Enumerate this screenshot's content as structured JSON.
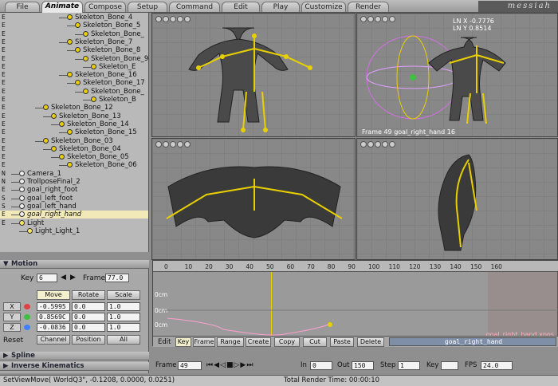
{
  "tabs": [
    "File",
    "Animate",
    "Compose",
    "Setup",
    "Command",
    "Edit",
    "Play",
    "Customize",
    "Render"
  ],
  "logo": "messiah",
  "tree": [
    {
      "flag": "E",
      "label": "Skeleton_Bone_4"
    },
    {
      "flag": "E",
      "label": "Skeleton_Bone_5"
    },
    {
      "flag": "E",
      "label": "Skeleton_Bone_"
    },
    {
      "flag": "E",
      "label": "Skeleton_Bone_7"
    },
    {
      "flag": "E",
      "label": "Skeleton_Bone_8"
    },
    {
      "flag": "E",
      "label": "Skeleton_Bone_9"
    },
    {
      "flag": "E",
      "label": "Skeleton_E"
    },
    {
      "flag": "E",
      "label": "Skeleton_Bone_16"
    },
    {
      "flag": "E",
      "label": "Skeleton_Bone_17"
    },
    {
      "flag": "E",
      "label": "Skeleton_Bone_"
    },
    {
      "flag": "E",
      "label": "Skeleton_B"
    },
    {
      "flag": "E",
      "label": "Skeleton_Bone_12"
    },
    {
      "flag": "E",
      "label": "Skeleton_Bone_13"
    },
    {
      "flag": "E",
      "label": "Skeleton_Bone_14"
    },
    {
      "flag": "E",
      "label": "Skeleton_Bone_15"
    },
    {
      "flag": "E",
      "label": "Skeleton_Bone_03"
    },
    {
      "flag": "E",
      "label": "Skeleton_Bone_04"
    },
    {
      "flag": "E",
      "label": "Skeleton_Bone_05"
    },
    {
      "flag": "E",
      "label": "Skeleton_Bone_06"
    },
    {
      "flag": "N",
      "label": "Camera_1"
    },
    {
      "flag": "N",
      "label": "TrollposeFinal_2"
    },
    {
      "flag": "E",
      "label": "goal_right_foot"
    },
    {
      "flag": "S",
      "label": "goal_left_foot"
    },
    {
      "flag": "S",
      "label": "goal_left_hand"
    },
    {
      "flag": "E",
      "label": "goal_right_hand"
    },
    {
      "flag": "E",
      "label": "Light"
    },
    {
      "flag": "",
      "label": "Light_Light_1"
    }
  ],
  "motion": {
    "title": "Motion",
    "key_label": "Key",
    "key_value": "6",
    "frame_label": "Frame",
    "frame_value": "77.0",
    "move": "Move",
    "rotate": "Rotate",
    "scale": "Scale",
    "axes": [
      {
        "axis": "X",
        "move": "-0.5995",
        "rotate": "0.0",
        "scale": "1.0"
      },
      {
        "axis": "Y",
        "move": "0.8569C",
        "rotate": "0.0",
        "scale": "1.0"
      },
      {
        "axis": "Z",
        "move": "-0.0836",
        "rotate": "0.0",
        "scale": "1.0"
      }
    ],
    "reset_label": "Reset",
    "channel": "Channel",
    "position": "Position",
    "all": "All",
    "spline": "Spline",
    "ik": "Inverse Kinematics"
  },
  "viewports": {
    "perspective_readout_1": "LN X -0.7776",
    "perspective_readout_2": "LN Y 0.8514",
    "perspective_footer": "Frame 49  goal_right_hand 16",
    "header_letters": "C P F T R"
  },
  "timeline": {
    "ticks": [
      "0",
      "10",
      "20",
      "30",
      "40",
      "50",
      "60",
      "70",
      "80",
      "90",
      "100",
      "110",
      "120",
      "130",
      "140",
      "150",
      "160"
    ],
    "ylabels": [
      "0cm",
      "0cm",
      "0cm"
    ],
    "curve_label": "goal_right_hand.xpos",
    "edit_label": "Edit",
    "edit_buttons": [
      "Key",
      "Frame",
      "Range",
      "Create",
      "Copy",
      "Cut",
      "Paste",
      "Delete"
    ],
    "item_name": "goal_right_hand"
  },
  "controls": {
    "frame_label": "Frame",
    "frame_value": "49",
    "in_label": "In",
    "in_value": "0",
    "out_label": "Out",
    "out_value": "150",
    "step_label": "Step",
    "step_value": "1",
    "key_label": "Key",
    "fps_label": "FPS",
    "fps_value": "24.0"
  },
  "status": {
    "command": "SetViewMove( WorldQ3\", -0.1208, 0.0000, 0.0251)",
    "render_time": "Total Render Time: 00:00:10"
  },
  "colors": {
    "accent": "#e8d000",
    "curve": "#ff9fd0",
    "selection": "#f2e9b8"
  }
}
